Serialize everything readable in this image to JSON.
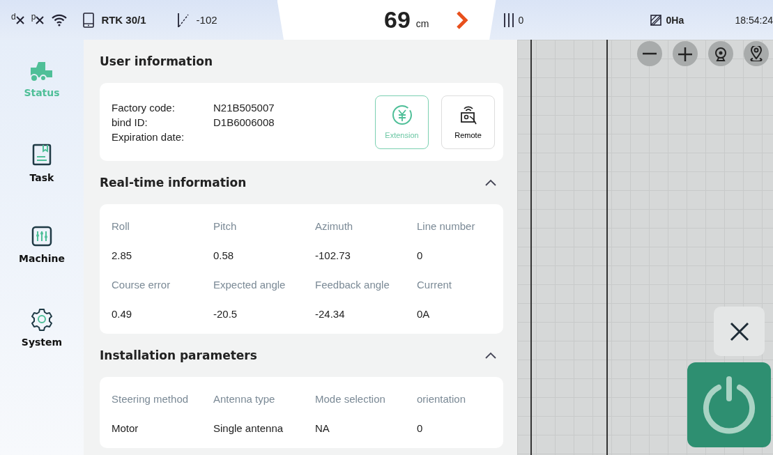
{
  "status_bar": {
    "base_labels": [
      "d",
      "p"
    ],
    "rtk": "RTK 30/1",
    "heading": "-102",
    "distance": "69",
    "distance_unit": "cm",
    "lines": "0",
    "area": "0Ha",
    "time": "18:54:24"
  },
  "sidebar": {
    "items": [
      {
        "kind": "tractor",
        "label": "Status",
        "selected": true
      },
      {
        "kind": "task",
        "label": "Task",
        "selected": false
      },
      {
        "kind": "machine",
        "label": "Machine",
        "selected": false
      },
      {
        "kind": "system",
        "label": "System",
        "selected": false
      }
    ]
  },
  "user_info": {
    "title": "User information",
    "fields": [
      {
        "label": "Factory code:",
        "value": "N21B505007"
      },
      {
        "label": "bind ID:",
        "value": "D1B6006008"
      },
      {
        "label": "Expiration date:"
      }
    ],
    "buttons": [
      {
        "kind": "extension",
        "label": "Extension"
      },
      {
        "kind": "remote",
        "label": "Remote"
      }
    ]
  },
  "sections": [
    {
      "title": "Real-time information",
      "expanded": true,
      "items": [
        {
          "label": "Roll",
          "value": "2.85"
        },
        {
          "label": "Pitch",
          "value": "0.58"
        },
        {
          "label": "Azimuth",
          "value": "-102.73"
        },
        {
          "label": "Line number",
          "value": "0"
        },
        {
          "label": "Course error",
          "value": "0.49"
        },
        {
          "label": "Expected angle",
          "value": "-20.5"
        },
        {
          "label": "Feedback angle",
          "value": "-24.34"
        },
        {
          "label": "Current",
          "value": "0A"
        }
      ]
    },
    {
      "title": "Installation parameters",
      "expanded": true,
      "items": [
        {
          "label": "Steering method",
          "value": "Motor"
        },
        {
          "label": "Antenna type",
          "value": "Single antenna"
        },
        {
          "label": "Mode selection",
          "value": "NA"
        },
        {
          "label": "orientation",
          "value": "0"
        }
      ]
    }
  ],
  "map": {
    "controls": [
      {
        "kind": "minus"
      },
      {
        "kind": "plus"
      },
      {
        "kind": "camera"
      },
      {
        "kind": "location"
      }
    ]
  }
}
